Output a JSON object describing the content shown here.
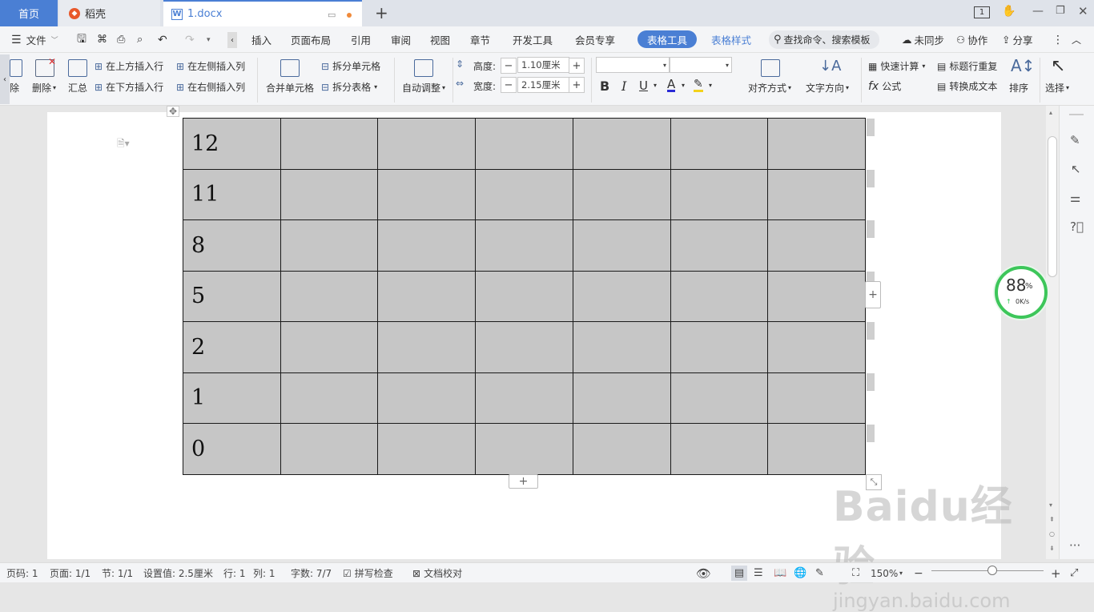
{
  "tabs": {
    "home": "首页",
    "daoke": "稻壳",
    "doc": "1.docx",
    "new_tab": "+"
  },
  "window": {
    "page_count_badge": "1"
  },
  "menu": {
    "file": "文件",
    "items": [
      "插入",
      "页面布局",
      "引用",
      "审阅",
      "视图",
      "章节",
      "开发工具",
      "会员专享"
    ],
    "active_tool": "表格工具",
    "table_style": "表格样式",
    "search_placeholder": "查找命令、搜索模板",
    "unsync": "未同步",
    "collab": "协作",
    "share": "分享"
  },
  "ribbon": {
    "delete_partial": "除",
    "delete": "删除",
    "summary": "汇总",
    "insert_above": "在上方插入行",
    "insert_below": "在下方插入行",
    "insert_left": "在左侧插入列",
    "insert_right": "在右侧插入列",
    "merge_cells": "合并单元格",
    "split_cells": "拆分单元格",
    "split_table": "拆分表格",
    "auto_fit": "自动调整",
    "height_label": "高度:",
    "height_value": "1.10厘米",
    "width_label": "宽度:",
    "width_value": "2.15厘米",
    "align": "对齐方式",
    "text_dir": "文字方向",
    "quick_calc": "快速计算",
    "formula": "公式",
    "repeat_header": "标题行重复",
    "to_text": "转换成文本",
    "sort": "排序",
    "select": "选择"
  },
  "table": {
    "rows": [
      "12",
      "11",
      "8",
      "5",
      "2",
      "1",
      "0"
    ],
    "columns": 7
  },
  "gauge": {
    "percent": "88",
    "percent_sign": "%",
    "speed": "0K/s"
  },
  "status": {
    "page_code": "页码: 1",
    "pages": "页面: 1/1",
    "section": "节: 1/1",
    "setting": "设置值: 2.5厘米",
    "row": "行: 1",
    "col": "列: 1",
    "word_count": "字数: 7/7",
    "spell_check": "拼写检查",
    "doc_proof": "文档校对",
    "zoom": "150%"
  },
  "watermark": {
    "brand": "Baidu经验",
    "url": "jingyan.baidu.com"
  },
  "colors": {
    "accent": "#4a7fd4",
    "table_fill": "#c6c6c6",
    "gauge": "#3dc65a"
  }
}
